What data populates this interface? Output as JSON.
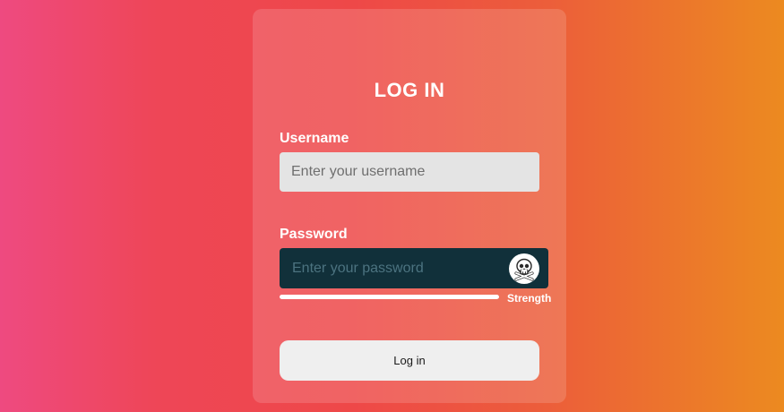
{
  "form": {
    "title": "LOG IN",
    "username": {
      "label": "Username",
      "placeholder": "Enter your username",
      "value": ""
    },
    "password": {
      "label": "Password",
      "placeholder": "Enter your password",
      "value": "",
      "toggle_icon": "skull-crossbones-icon"
    },
    "strength": {
      "label": "Strength",
      "level": 1.0
    },
    "submit_label": "Log in"
  },
  "colors": {
    "gradient_left": "#ee4a80",
    "gradient_right": "#ec8a20",
    "username_field_bg": "#e4e4e4",
    "password_field_bg": "#11303a",
    "button_bg": "#efefef"
  }
}
